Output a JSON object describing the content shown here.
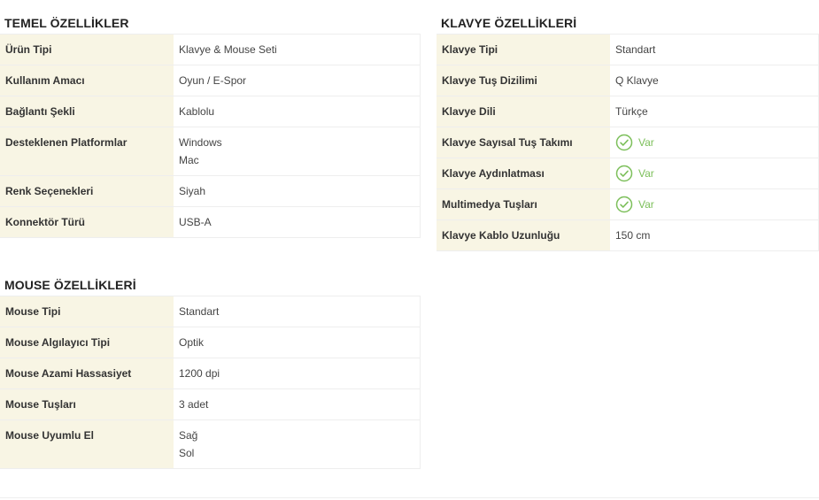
{
  "temel": {
    "title": "TEMEL ÖZELLİKLER",
    "rows": [
      {
        "label": "Ürün Tipi",
        "value": "Klavye & Mouse Seti"
      },
      {
        "label": "Kullanım Amacı",
        "value": "Oyun / E-Spor"
      },
      {
        "label": "Bağlantı Şekli",
        "value": "Kablolu"
      },
      {
        "label": "Desteklenen Platformlar",
        "value_lines": [
          "Windows",
          "Mac"
        ]
      },
      {
        "label": "Renk Seçenekleri",
        "value": "Siyah"
      },
      {
        "label": "Konnektör Türü",
        "value": "USB-A"
      }
    ]
  },
  "klavye": {
    "title": "KLAVYE ÖZELLİKLERİ",
    "rows": [
      {
        "label": "Klavye Tipi",
        "value": "Standart"
      },
      {
        "label": "Klavye Tuş Dizilimi",
        "value": "Q Klavye"
      },
      {
        "label": "Klavye Dili",
        "value": "Türkçe"
      },
      {
        "label": "Klavye Sayısal Tuş Takımı",
        "value": "Var",
        "icon": "check-circle-icon"
      },
      {
        "label": "Klavye Aydınlatması",
        "value": "Var",
        "icon": "check-circle-icon"
      },
      {
        "label": "Multimedya Tuşları",
        "value": "Var",
        "icon": "check-circle-icon"
      },
      {
        "label": "Klavye Kablo Uzunluğu",
        "value": "150 cm"
      }
    ]
  },
  "mouse": {
    "title": "MOUSE ÖZELLİKLERİ",
    "rows": [
      {
        "label": "Mouse Tipi",
        "value": "Standart"
      },
      {
        "label": "Mouse Algılayıcı Tipi",
        "value": "Optik"
      },
      {
        "label": "Mouse Azami Hassasiyet",
        "value": "1200 dpi"
      },
      {
        "label": "Mouse Tuşları",
        "value": "3 adet"
      },
      {
        "label": "Mouse Uyumlu El",
        "value_lines": [
          "Sağ",
          "Sol"
        ]
      }
    ]
  },
  "colors": {
    "label_bg": "#f8f5e4",
    "border": "#eeeeee",
    "check_green": "#7cbf5a",
    "title_text": "#222222"
  }
}
